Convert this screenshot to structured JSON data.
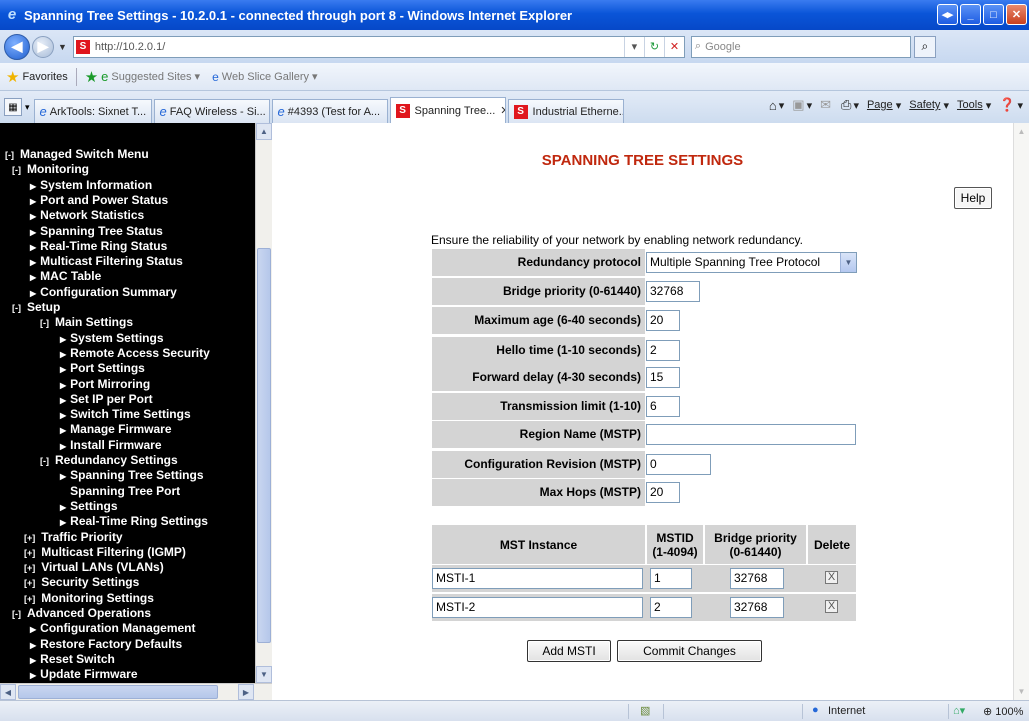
{
  "window": {
    "title": "Spanning Tree Settings - 10.2.0.1 - connected through port 8 - Windows Internet Explorer"
  },
  "address_bar": {
    "url": "http://10.2.0.1/",
    "favicon_letter": "S"
  },
  "search": {
    "placeholder": "Google"
  },
  "favorites_bar": {
    "favorites_label": "Favorites",
    "items": [
      {
        "label": "Suggested Sites ▾"
      },
      {
        "label": "Web Slice Gallery ▾"
      }
    ]
  },
  "tabs": [
    {
      "label": "ArkTools: Sixnet T...",
      "active": false,
      "icon": "ie-icon"
    },
    {
      "label": "FAQ Wireless - Si...",
      "active": false,
      "icon": "ie-icon"
    },
    {
      "label": "#4393 (Test for A...",
      "active": false,
      "icon": "ie-icon"
    },
    {
      "label": "Spanning Tree...",
      "active": true,
      "icon": "sixnet-icon"
    },
    {
      "label": "Industrial Etherne...",
      "active": false,
      "icon": "sixnet-icon"
    }
  ],
  "command_bar": {
    "page": "Page",
    "safety": "Safety",
    "tools": "Tools"
  },
  "sidebar": {
    "lines": [
      {
        "toggle": "[-]",
        "label": "Managed Switch Menu",
        "level": 0
      },
      {
        "toggle": "[-]",
        "label": "Monitoring",
        "level": 1
      },
      {
        "arrow": true,
        "label": "System Information",
        "level": 2
      },
      {
        "arrow": true,
        "label": "Port and Power Status",
        "level": 2
      },
      {
        "arrow": true,
        "label": "Network Statistics",
        "level": 2
      },
      {
        "arrow": true,
        "label": "Spanning Tree Status",
        "level": 2
      },
      {
        "arrow": true,
        "label": "Real-Time Ring Status",
        "level": 2
      },
      {
        "arrow": true,
        "label": "Multicast Filtering Status",
        "level": 2
      },
      {
        "arrow": true,
        "label": "MAC Table",
        "level": 2
      },
      {
        "arrow": true,
        "label": "Configuration Summary",
        "level": 2
      },
      {
        "toggle": "[-]",
        "label": "Setup",
        "level": 1
      },
      {
        "toggle": "[-]",
        "label": "Main Settings",
        "level": 2
      },
      {
        "arrow": true,
        "label": "System Settings",
        "level": 3
      },
      {
        "arrow": true,
        "label": "Remote Access Security",
        "level": 3
      },
      {
        "arrow": true,
        "label": "Port Settings",
        "level": 3
      },
      {
        "arrow": true,
        "label": "Port Mirroring",
        "level": 3
      },
      {
        "arrow": true,
        "label": "Set IP per Port",
        "level": 3
      },
      {
        "arrow": true,
        "label": "Switch Time Settings",
        "level": 3
      },
      {
        "arrow": true,
        "label": "Manage Firmware",
        "level": 3
      },
      {
        "arrow": true,
        "label": "Install Firmware",
        "level": 3
      },
      {
        "toggle": "[-]",
        "label": "Redundancy Settings",
        "level": 2
      },
      {
        "arrow": true,
        "label": "Spanning Tree Settings",
        "level": 3
      },
      {
        "arrow": false,
        "label": "Spanning Tree Port",
        "level": 3
      },
      {
        "arrow": true,
        "label": "Settings",
        "level": 3
      },
      {
        "arrow": true,
        "label": "Real-Time Ring Settings",
        "level": 3
      },
      {
        "toggle": "[+]",
        "label": "Traffic Priority",
        "level": 2
      },
      {
        "toggle": "[+]",
        "label": "Multicast Filtering (IGMP)",
        "level": 2
      },
      {
        "toggle": "[+]",
        "label": "Virtual LANs (VLANs)",
        "level": 2
      },
      {
        "toggle": "[+]",
        "label": "Security Settings",
        "level": 2
      },
      {
        "toggle": "[+]",
        "label": "Monitoring Settings",
        "level": 2
      },
      {
        "toggle": "[-]",
        "label": "Advanced Operations",
        "level": 1
      },
      {
        "arrow": true,
        "label": "Configuration Management",
        "level": 2
      },
      {
        "arrow": true,
        "label": "Restore Factory Defaults",
        "level": 2
      },
      {
        "arrow": true,
        "label": "Reset Switch",
        "level": 2
      },
      {
        "arrow": true,
        "label": "Update Firmware",
        "level": 2
      }
    ]
  },
  "page": {
    "title": "SPANNING TREE SETTINGS",
    "help_label": "Help",
    "intro": "Ensure the reliability of your network by enabling network redundancy."
  },
  "settings": {
    "redundancy_protocol": {
      "label": "Redundancy protocol",
      "value": "Multiple Spanning Tree Protocol"
    },
    "bridge_priority": {
      "label": "Bridge priority (0-61440)",
      "value": "32768"
    },
    "max_age": {
      "label": "Maximum age (6-40 seconds)",
      "value": "20"
    },
    "hello_time": {
      "label": "Hello time (1-10 seconds)",
      "value": "2"
    },
    "forward_delay": {
      "label": "Forward delay (4-30 seconds)",
      "value": "15"
    },
    "transmission_limit": {
      "label": "Transmission limit (1-10)",
      "value": "6"
    },
    "region_name": {
      "label": "Region Name (MSTP)",
      "value": ""
    },
    "config_revision": {
      "label": "Configuration Revision (MSTP)",
      "value": "0"
    },
    "max_hops": {
      "label": "Max Hops (MSTP)",
      "value": "20"
    }
  },
  "mst_table": {
    "headers": {
      "instance": "MST Instance",
      "mstid_1": "MSTID",
      "mstid_2": "(1-4094)",
      "bridge_1": "Bridge priority",
      "bridge_2": "(0-61440)",
      "delete": "Delete"
    },
    "rows": [
      {
        "instance": "MSTI-1",
        "mstid": "1",
        "bridge_priority": "32768",
        "delete_mark": "X"
      },
      {
        "instance": "MSTI-2",
        "mstid": "2",
        "bridge_priority": "32768",
        "delete_mark": "X"
      }
    ]
  },
  "buttons": {
    "add_msti": "Add MSTI",
    "commit": "Commit Changes"
  },
  "status_bar": {
    "zone": "Internet",
    "zoom": "100%"
  },
  "colors": {
    "title_red": "#c0280e",
    "row_gray": "#d4d4d4",
    "sidebar_bg": "#000000"
  }
}
